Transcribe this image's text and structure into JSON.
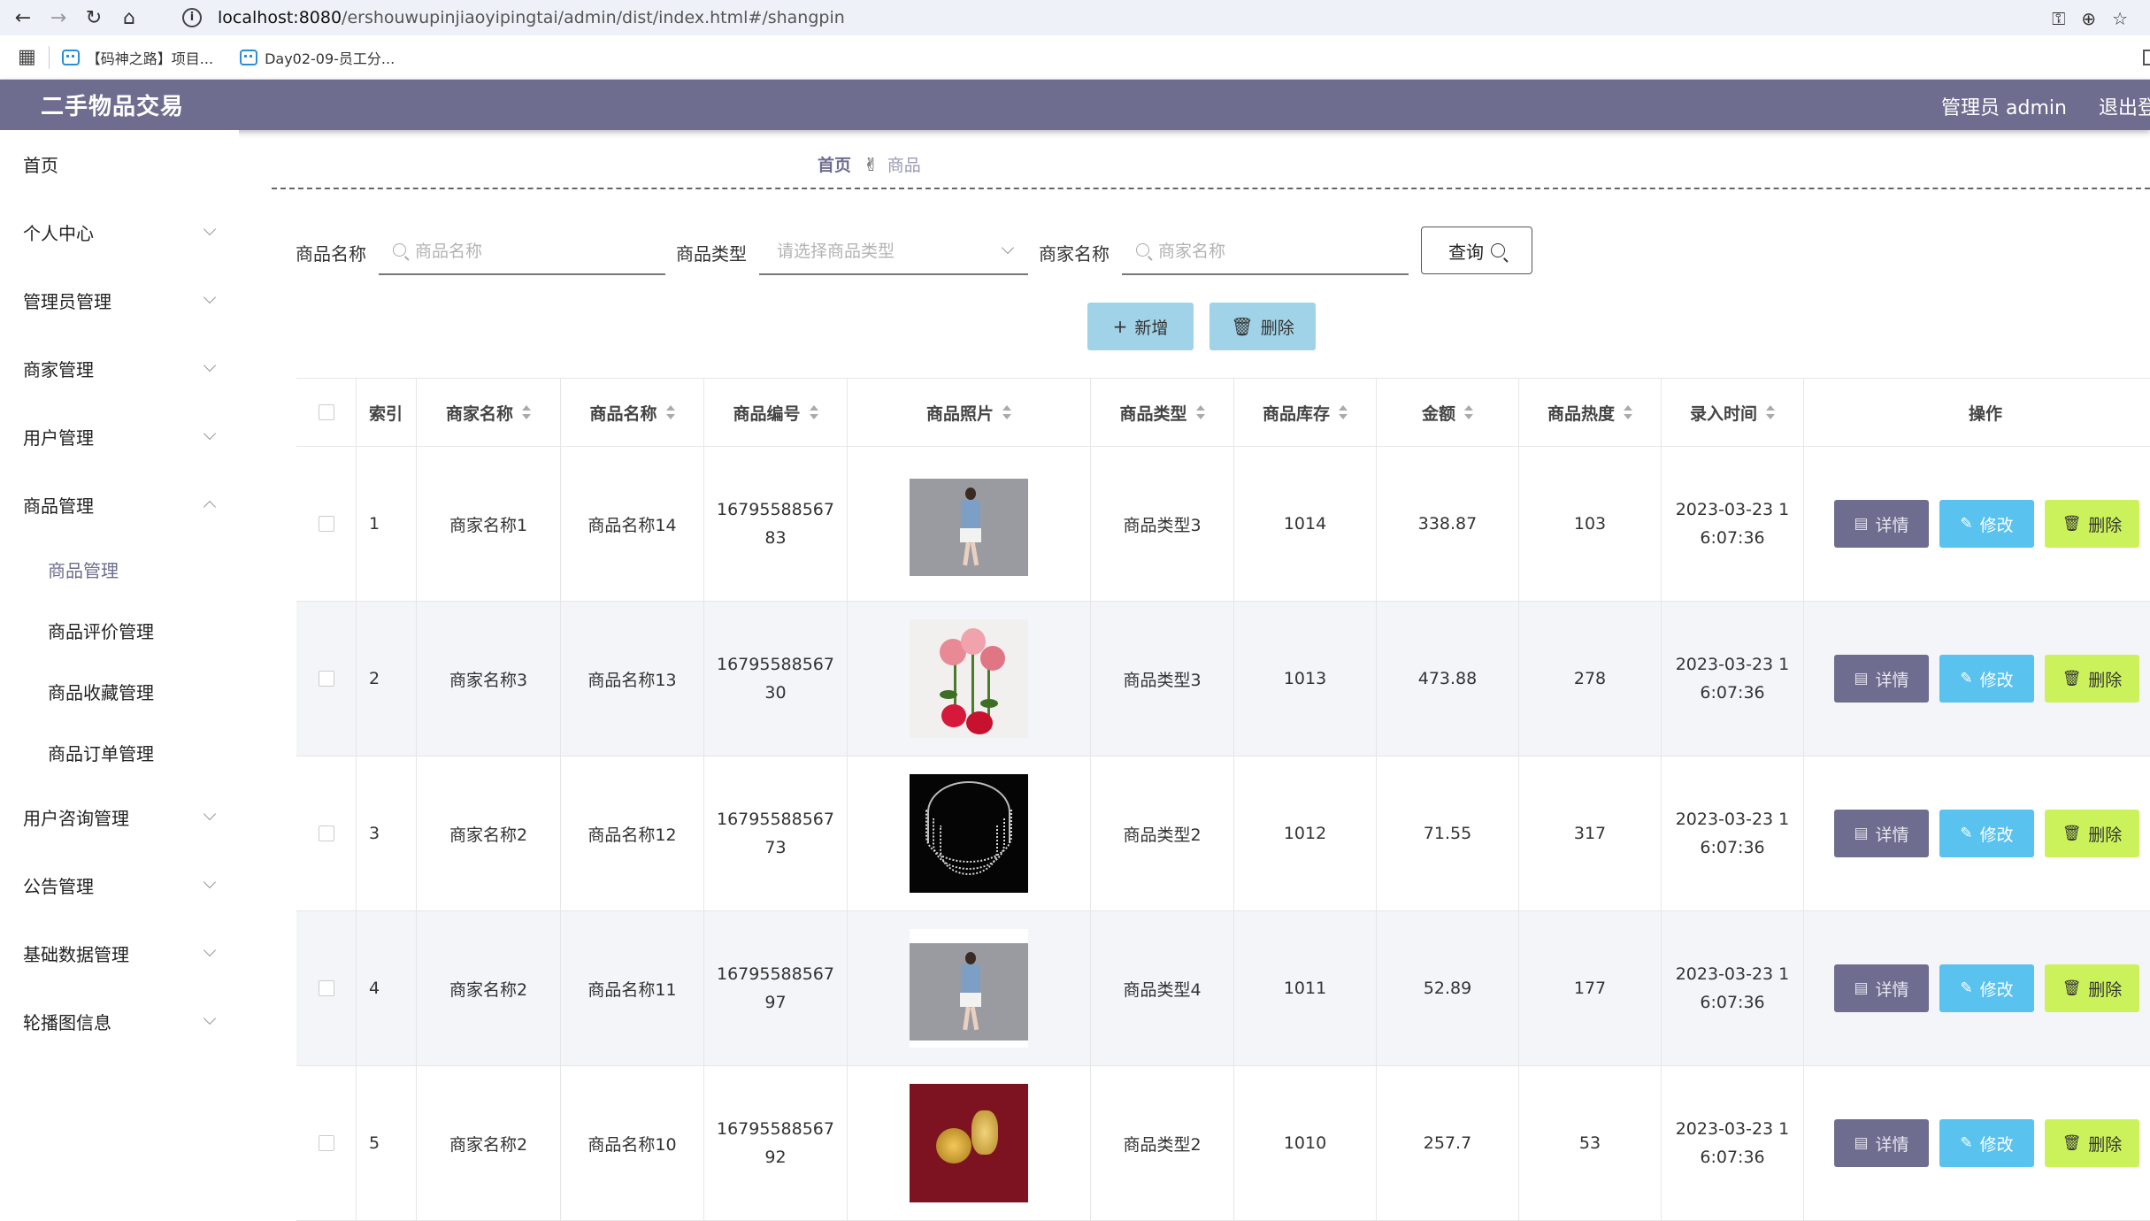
{
  "browser": {
    "url_host": "localhost:8080",
    "url_path": "/ershouwupinjiaoyipingtai/admin/dist/index.html#/shangpin",
    "bookmarks": [
      {
        "label": "【码神之路】项目..."
      },
      {
        "label": "Day02-09-员工分..."
      }
    ]
  },
  "header": {
    "title": "二手物品交易",
    "user_label": "管理员 admin",
    "logout_label": "退出登录"
  },
  "sidebar": {
    "items": [
      {
        "label": "首页"
      },
      {
        "label": "个人中心"
      },
      {
        "label": "管理员管理"
      },
      {
        "label": "商家管理"
      },
      {
        "label": "用户管理"
      },
      {
        "label": "商品管理"
      },
      {
        "label": "用户咨询管理"
      },
      {
        "label": "公告管理"
      },
      {
        "label": "基础数据管理"
      },
      {
        "label": "轮播图信息"
      }
    ],
    "sub_items": [
      {
        "label": "商品管理"
      },
      {
        "label": "商品评价管理"
      },
      {
        "label": "商品收藏管理"
      },
      {
        "label": "商品订单管理"
      }
    ]
  },
  "breadcrumb": {
    "home": "首页",
    "current": "商品"
  },
  "search": {
    "name_label": "商品名称",
    "name_placeholder": "商品名称",
    "type_label": "商品类型",
    "type_placeholder": "请选择商品类型",
    "merchant_label": "商家名称",
    "merchant_placeholder": "商家名称",
    "query_label": "查询"
  },
  "actions": {
    "add_label": "新增",
    "delete_label": "删除"
  },
  "table": {
    "headers": {
      "index": "索引",
      "merchant": "商家名称",
      "name": "商品名称",
      "code": "商品编号",
      "photo": "商品照片",
      "type": "商品类型",
      "stock": "商品库存",
      "price": "金额",
      "heat": "商品热度",
      "time": "录入时间",
      "ops": "操作"
    },
    "op_labels": {
      "detail": "详情",
      "edit": "修改",
      "delete": "删除"
    },
    "rows": [
      {
        "index": "1",
        "merchant": "商家名称1",
        "name": "商品名称14",
        "code": "1679558856783",
        "type": "商品类型3",
        "stock": "1014",
        "price": "338.87",
        "heat": "103",
        "time": "2023-03-23 16:07:36",
        "photo": "woman-photo"
      },
      {
        "index": "2",
        "merchant": "商家名称3",
        "name": "商品名称13",
        "code": "1679558856730",
        "type": "商品类型3",
        "stock": "1013",
        "price": "473.88",
        "heat": "278",
        "time": "2023-03-23 16:07:36",
        "photo": "roses-photo"
      },
      {
        "index": "3",
        "merchant": "商家名称2",
        "name": "商品名称12",
        "code": "1679558856773",
        "type": "商品类型2",
        "stock": "1012",
        "price": "71.55",
        "heat": "317",
        "time": "2023-03-23 16:07:36",
        "photo": "necklace-photo"
      },
      {
        "index": "4",
        "merchant": "商家名称2",
        "name": "商品名称11",
        "code": "1679558856797",
        "type": "商品类型4",
        "stock": "1011",
        "price": "52.89",
        "heat": "177",
        "time": "2023-03-23 16:07:36",
        "photo": "woman-photo"
      },
      {
        "index": "5",
        "merchant": "商家名称2",
        "name": "商品名称10",
        "code": "1679558856792",
        "type": "商品类型2",
        "stock": "1010",
        "price": "257.7",
        "heat": "53",
        "time": "2023-03-23 16:07:36",
        "photo": "gold-photo"
      }
    ]
  },
  "colors": {
    "header_bg": "#6e6d8f",
    "detail_btn": "#6e6d8f",
    "edit_btn": "#59c2ee",
    "delete_btn": "#ccf25b",
    "action_btn": "#a1d3e8"
  }
}
